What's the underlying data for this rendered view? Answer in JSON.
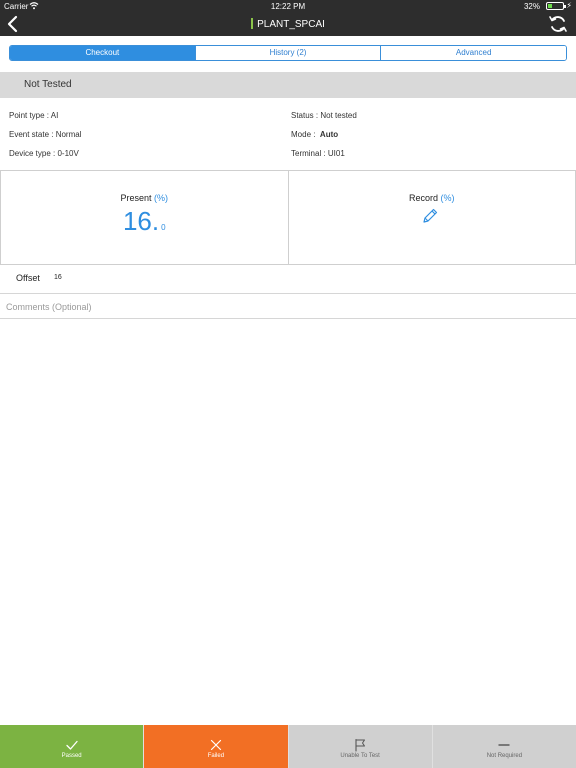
{
  "status_bar": {
    "carrier": "Carrier",
    "time": "12:22 PM",
    "battery_percent": "32%",
    "battery_level": 0.32,
    "wifi_icon": "wifi-icon"
  },
  "nav": {
    "title": "PLANT_SPCAI",
    "back_icon": "chevron-left-icon",
    "refresh_icon": "refresh-icon"
  },
  "tabs": [
    {
      "label": "Checkout",
      "active": true
    },
    {
      "label": "History (2)",
      "active": false
    },
    {
      "label": "Advanced",
      "active": false
    }
  ],
  "section": {
    "header": "Not Tested"
  },
  "info": {
    "point_type": "Point type : AI",
    "event_state": "Event state : Normal",
    "device_type": "Device type : 0-10V",
    "status": "Status : Not tested",
    "mode_label": "Mode :",
    "mode_value": "Auto",
    "terminal": "Terminal : UI01"
  },
  "present": {
    "label": "Present",
    "unit": "(%)",
    "value_int": "16.",
    "value_dec": "0"
  },
  "record": {
    "label": "Record",
    "unit": "(%)",
    "icon": "pencil-icon"
  },
  "offset": {
    "label": "Offset",
    "value": "16"
  },
  "comments": {
    "placeholder": "Comments (Optional)",
    "value": ""
  },
  "actions": [
    {
      "label": "Passed",
      "icon": "check-icon",
      "color": "#7cb342"
    },
    {
      "label": "Failed",
      "icon": "close-icon",
      "color": "#f26f24"
    },
    {
      "label": "Unable To Test",
      "icon": "flag-icon",
      "color": "#d0d0d0"
    },
    {
      "label": "Not Required",
      "icon": "minus-icon",
      "color": "#d0d0d0"
    }
  ],
  "colors": {
    "accent": "#2f8ee0",
    "nav_bg": "#2d2d2d",
    "header_bg": "#d9d9d9"
  }
}
